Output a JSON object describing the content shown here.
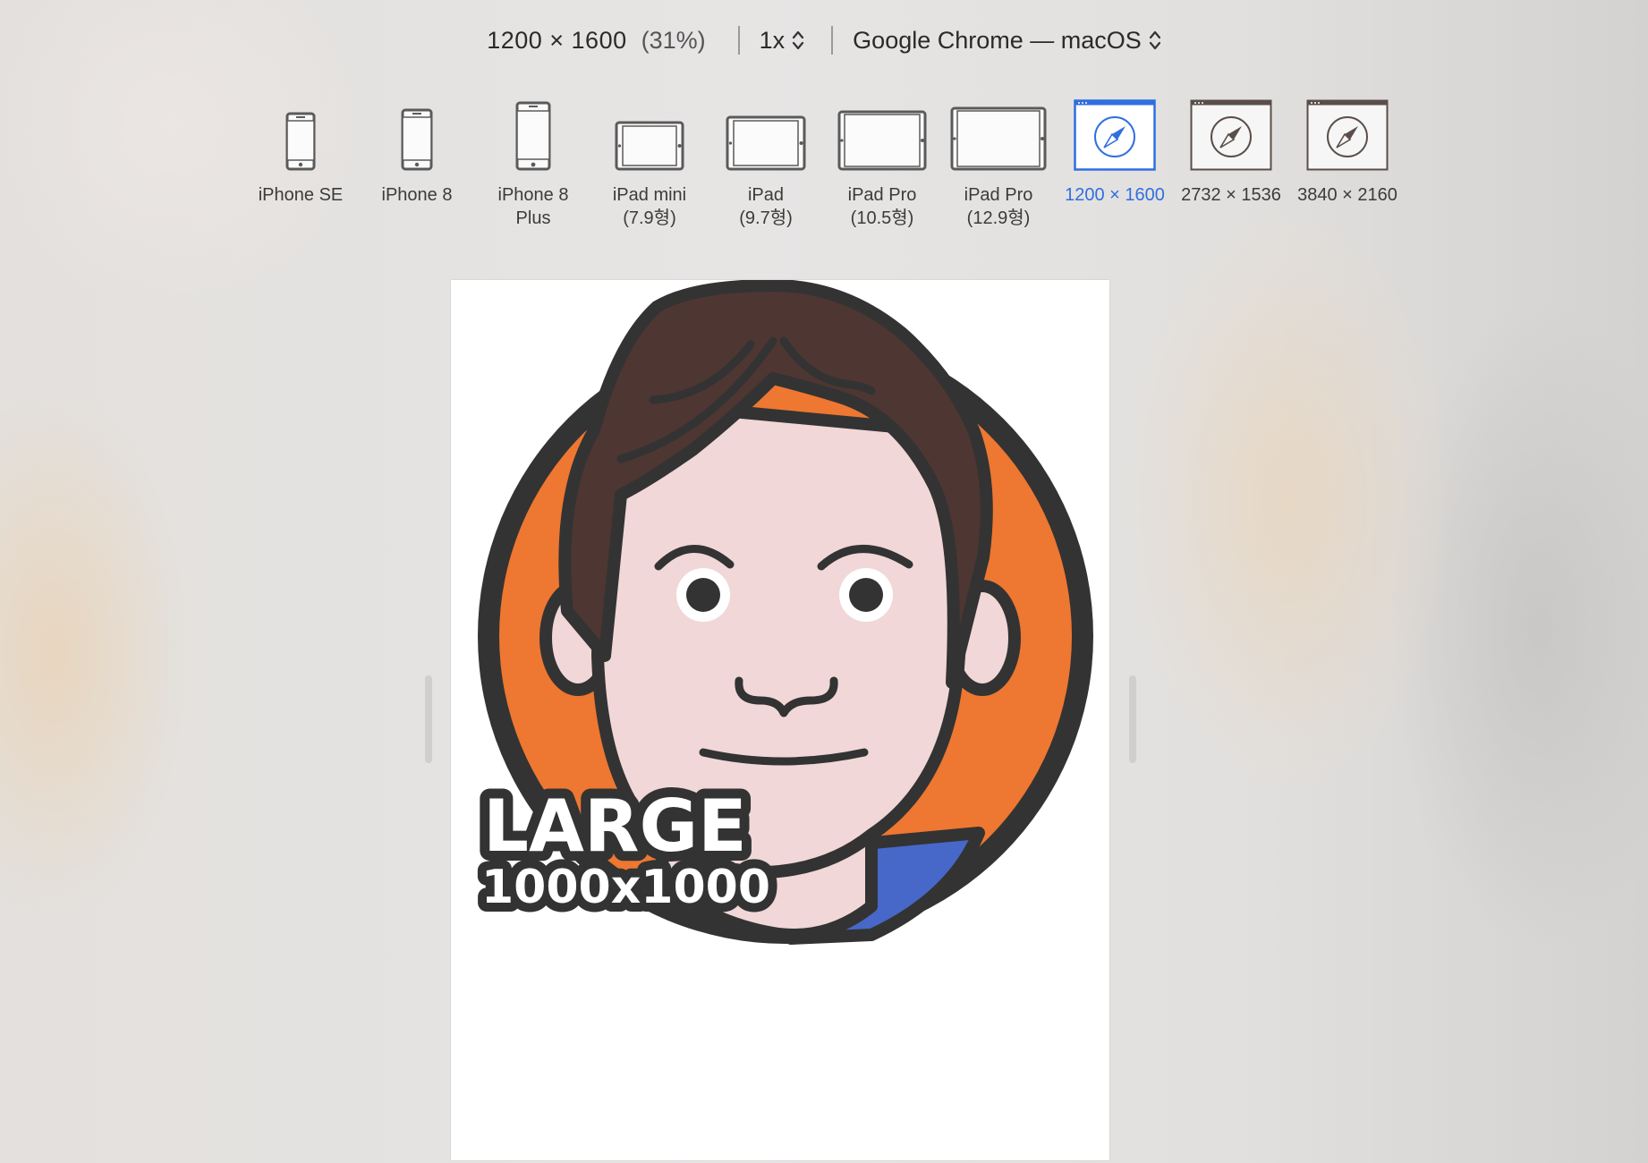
{
  "toolbar": {
    "dimensions": "1200 × 1600",
    "zoom_percent": "(31%)",
    "scale": "1x",
    "browser": "Google Chrome — macOS"
  },
  "devices": [
    {
      "label_line1": "iPhone SE",
      "label_line2": "",
      "icon": "phone-icon",
      "active": false
    },
    {
      "label_line1": "iPhone 8",
      "label_line2": "",
      "icon": "phone-icon",
      "active": false
    },
    {
      "label_line1": "iPhone 8",
      "label_line2": "Plus",
      "icon": "phone-icon",
      "active": false
    },
    {
      "label_line1": "iPad mini",
      "label_line2": "(7.9형)",
      "icon": "tablet-icon",
      "active": false
    },
    {
      "label_line1": "iPad",
      "label_line2": "(9.7형)",
      "icon": "tablet-icon",
      "active": false
    },
    {
      "label_line1": "iPad Pro",
      "label_line2": "(10.5형)",
      "icon": "tablet-icon",
      "active": false
    },
    {
      "label_line1": "iPad Pro",
      "label_line2": "(12.9형)",
      "icon": "tablet-icon",
      "active": false
    },
    {
      "label_line1": "1200 × 1600",
      "label_line2": "",
      "icon": "safari-window-icon",
      "active": true
    },
    {
      "label_line1": "2732 × 1536",
      "label_line2": "",
      "icon": "safari-window-icon",
      "active": false
    },
    {
      "label_line1": "3840 × 2160",
      "label_line2": "",
      "icon": "safari-window-icon",
      "active": false
    }
  ],
  "preview": {
    "badge_title": "LARGE",
    "badge_size": "1000x1000"
  },
  "colors": {
    "accent": "#2f6fe0",
    "orange": "#ee7731",
    "hair": "#4e3632",
    "skin": "#f1d7d7",
    "shirt": "#4768c8",
    "outline": "#333333"
  }
}
